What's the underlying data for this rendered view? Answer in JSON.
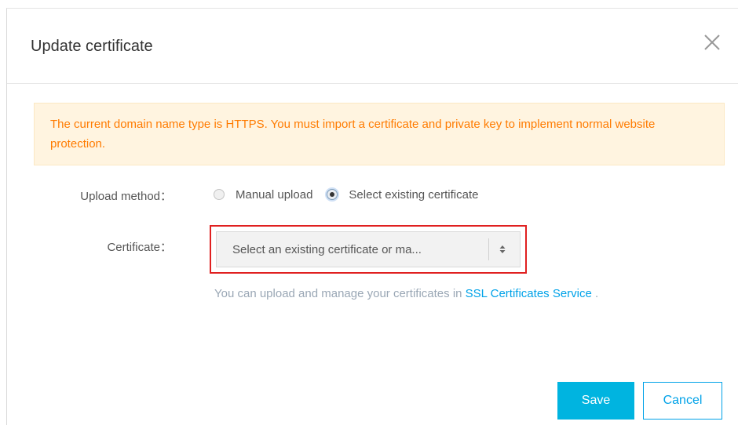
{
  "dialog": {
    "title": "Update certificate",
    "close_icon": "close-icon"
  },
  "alert": {
    "message": "The current domain name type is HTTPS. You must import a certificate and private key to implement normal website protection.",
    "color": "#ff7b00",
    "background": "#fff4e0"
  },
  "form": {
    "upload_method": {
      "label": "Upload method：",
      "options": [
        {
          "label": "Manual upload",
          "selected": false
        },
        {
          "label": "Select existing certificate",
          "selected": true
        }
      ]
    },
    "certificate": {
      "label": "Certificate：",
      "selected_value": "Select an existing certificate or ma...",
      "arrow_icon": "sort-arrows-icon"
    },
    "help": {
      "text": "You can upload and manage your certificates in",
      "link_text": "SSL Certificates Service",
      "suffix": " ."
    }
  },
  "footer": {
    "save_label": "Save",
    "cancel_label": "Cancel"
  },
  "colors": {
    "accent": "#00b4e0",
    "link": "#00a2e8",
    "highlight": "#e02020"
  }
}
